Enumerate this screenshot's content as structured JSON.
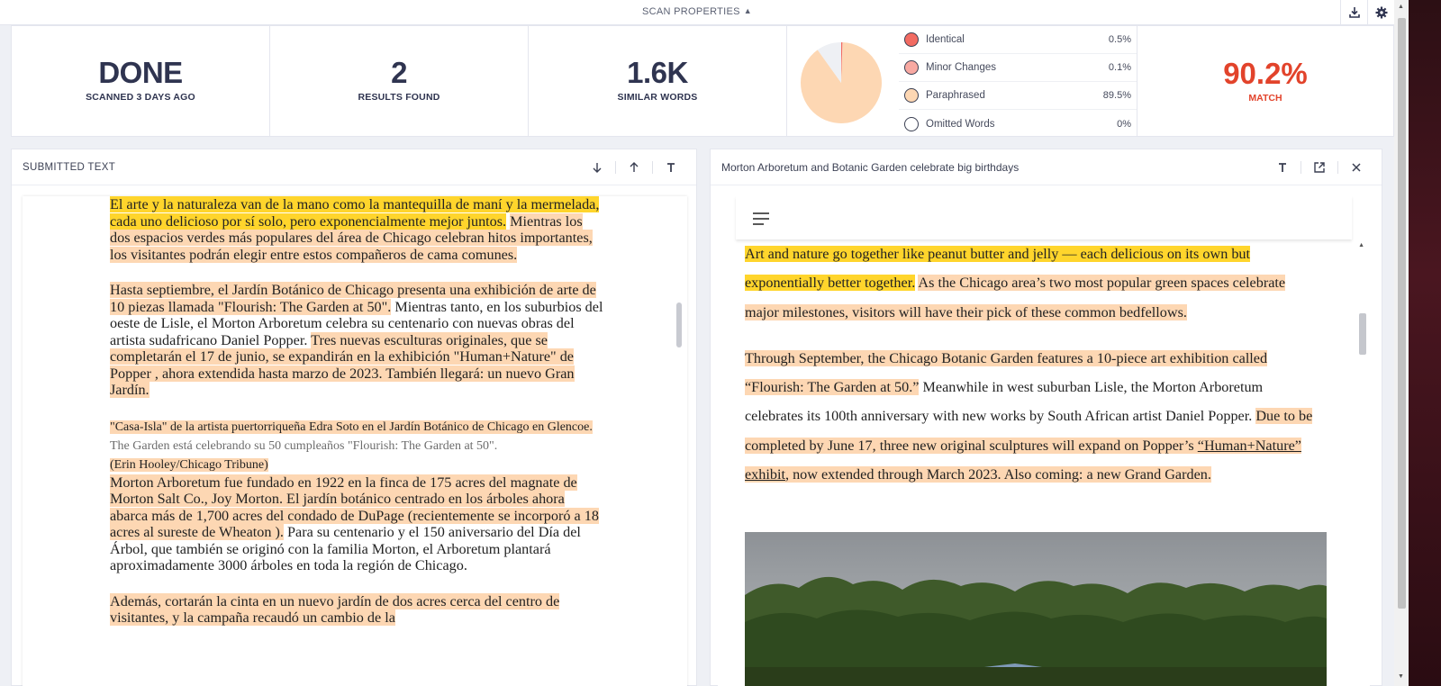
{
  "header": {
    "scan_properties_label": "SCAN PROPERTIES"
  },
  "stats": {
    "status": {
      "value": "DONE",
      "label": "SCANNED 3 DAYS AGO"
    },
    "results": {
      "value": "2",
      "label": "RESULTS FOUND"
    },
    "words": {
      "value": "1.6K",
      "label": "SIMILAR WORDS"
    },
    "match": {
      "value": "90.2%",
      "label": "MATCH"
    }
  },
  "legend": [
    {
      "label": "Identical",
      "value": "0.5%",
      "color": "#f26b62"
    },
    {
      "label": "Minor Changes",
      "value": "0.1%",
      "color": "#f8a9a2"
    },
    {
      "label": "Paraphrased",
      "value": "89.5%",
      "color": "#fdd7b3"
    },
    {
      "label": "Omitted Words",
      "value": "0%",
      "color": "#ffffff"
    }
  ],
  "pie": {
    "identical": 0.5,
    "minor": 0.1,
    "paraphrased": 89.5,
    "other": 9.9
  },
  "left_panel": {
    "title": "SUBMITTED TEXT",
    "paragraphs": [
      {
        "hl_yellow": "El arte y la naturaleza van de la mano como la mantequilla de maní y la mermelada, cada uno delicioso por sí solo, pero exponencialmente mejor juntos.",
        "hl_orange": "Mientras los dos espacios verdes más populares del área de Chicago celebran hitos importantes, los visitantes podrán elegir entre estos compañeros de cama comunes."
      },
      {
        "hl_orange_1": "Hasta septiembre, el Jardín Botánico de Chicago presenta una exhibición de arte de 10 piezas llamada \"Flourish: The Garden at 50\".",
        "plain": " Mientras tanto, en los suburbios del oeste de Lisle, el Morton Arboretum celebra su centenario con nuevas obras del artista sudafricano Daniel Popper. ",
        "hl_orange_2": "Tres nuevas esculturas originales, que se completarán el 17 de junio, se expandirán en la exhibición \"Human+Nature\" de Popper , ahora extendida hasta marzo de 2023. También llegará: un nuevo Gran Jardín."
      },
      {
        "hl_orange_1": "\"Casa-Isla\" de la artista puertorriqueña Edra Soto en el Jardín Botánico de Chicago en Glencoe.",
        "grey": " The Garden está celebrando su 50 cumpleaños \"Flourish: The Garden at 50\".",
        "hl_orange_2": "(Erin Hooley/Chicago Tribune)"
      },
      {
        "hl_orange": "Morton Arboretum fue fundado en 1922 en la finca de 175 acres del magnate de Morton Salt Co., Joy Morton. El jardín botánico centrado en los árboles ahora abarca más de 1,700 acres del condado de DuPage (recientemente se incorporó a 18 acres al sureste de Wheaton ).",
        "plain": " Para su centenario y el 150 aniversario del Día del Árbol, que también se originó con la familia Morton, el Arboretum plantará aproximadamente 3000 árboles en toda la región de Chicago."
      },
      {
        "hl_orange": "Además, cortarán la cinta en un nuevo jardín de dos acres cerca del centro de visitantes, y la campaña recaudó un cambio de la"
      }
    ]
  },
  "right_panel": {
    "title": "Morton Arboretum and Botanic Garden celebrate big birthdays",
    "paragraphs": [
      {
        "hl_yellow": "Art and nature go together like peanut butter and jelly — each delicious on its own but exponentially better together.",
        "hl_orange": "As the Chicago area’s two most popular green spaces celebrate major milestones, visitors will have their pick of these common bedfellows."
      },
      {
        "hl_orange_1": "Through September, the Chicago Botanic Garden features a 10-piece art exhibition called “Flourish: The Garden at 50.”",
        "plain": " Meanwhile in west suburban Lisle, the Morton Arboretum celebrates its 100th anniversary with new works by South African artist Daniel Popper. ",
        "hl_orange_2a": "Due to be completed by June 17, three new original sculptures will expand on Popper’s ",
        "link": "“Human+Nature” exhibit",
        "hl_orange_2b": ", now extended through March 2023. Also coming: a new Grand Garden."
      }
    ]
  }
}
